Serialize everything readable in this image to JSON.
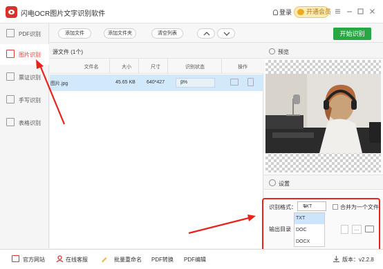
{
  "app": {
    "title": "闪电OCR图片文字识别软件",
    "login_label": "登录",
    "vip_label": "开通会员",
    "logo_icon": "lightning-eye-logo"
  },
  "window_controls": [
    "menu-icon",
    "minimize-icon",
    "maximize-icon",
    "close-icon"
  ],
  "sidebar": {
    "items": [
      {
        "label": "PDF识别",
        "icon": "pdf-icon",
        "active": false
      },
      {
        "label": "图片识别",
        "icon": "image-icon",
        "active": true
      },
      {
        "label": "票证识别",
        "icon": "ticket-icon",
        "active": false
      },
      {
        "label": "手写识别",
        "icon": "handwriting-icon",
        "active": false
      },
      {
        "label": "表格识别",
        "icon": "table-icon",
        "active": false
      }
    ]
  },
  "toolbar": {
    "add_file": "添加文件",
    "add_folder": "添加文件夹",
    "clear_list": "清空列表",
    "start_button": "开始识别"
  },
  "file_list": {
    "header": "源文件 (1个)",
    "columns": [
      "文件名",
      "大小",
      "尺寸",
      "识别状态",
      "操作"
    ],
    "rows": [
      {
        "name": "图片.jpg",
        "size": "45.65 KB",
        "dimensions": "640*427",
        "progress": "0%"
      }
    ]
  },
  "preview": {
    "title": "预览"
  },
  "settings": {
    "title": "设置",
    "format_label": "识别格式：",
    "format_selected": "TXT",
    "format_options": [
      "TXT",
      "DOC",
      "DOCX"
    ],
    "merge_label": "合并为一个文件",
    "output_label": "输出目录",
    "browse_label": "..."
  },
  "bottom_bar": {
    "website": "官方网站",
    "support": "在线客服",
    "rename": "批量重命名",
    "pdf_convert": "PDF转换",
    "pdf_edit": "PDF编辑",
    "version": "版本：v2.2.8"
  },
  "colors": {
    "accent_red": "#e03d33",
    "start_green": "#28a745",
    "selection_blue": "#d2e8fb",
    "annotation_red": "#e8231b"
  }
}
